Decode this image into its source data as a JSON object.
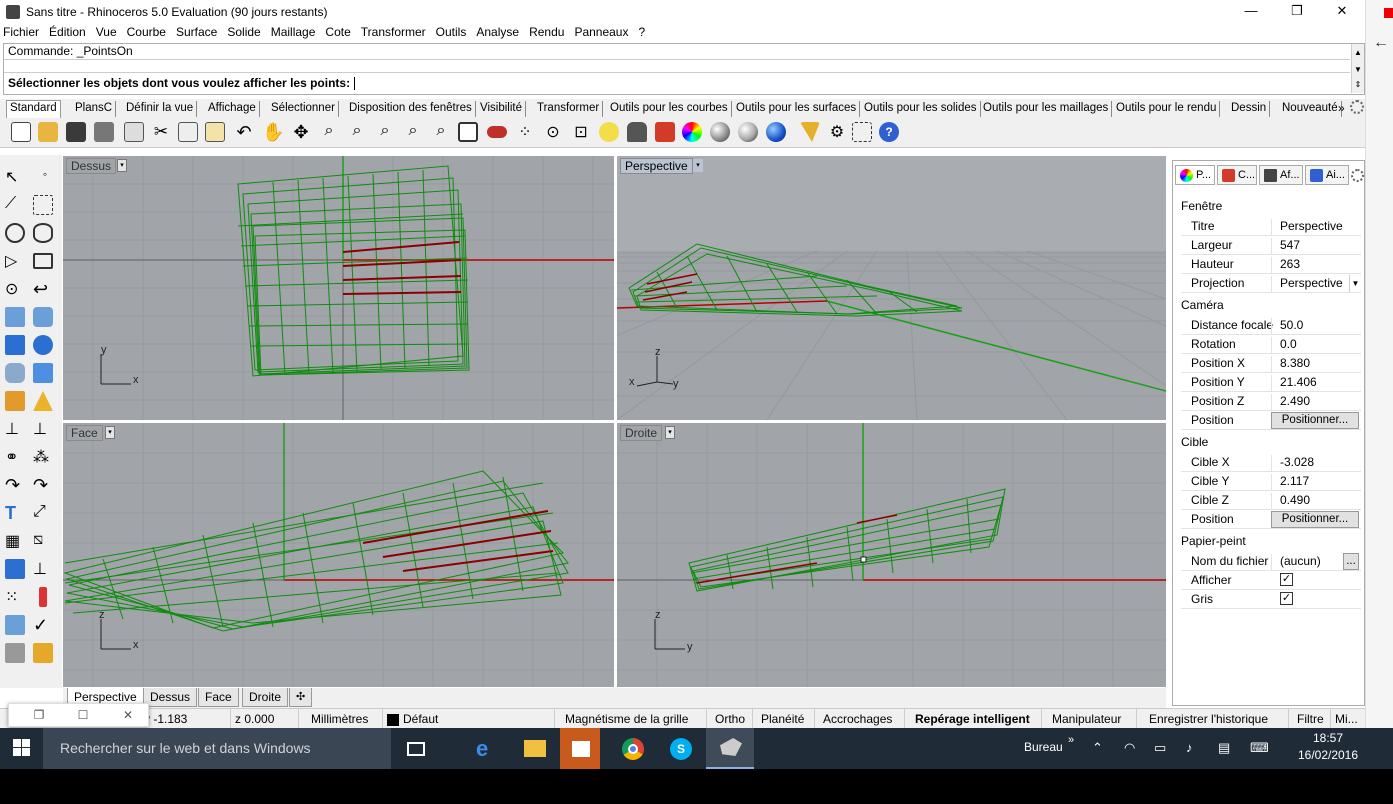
{
  "window": {
    "title": "Sans titre - Rhinoceros 5.0 Evaluation (90 jours restants)",
    "controls": {
      "minimize": "—",
      "restore": "❐",
      "close": "✕"
    }
  },
  "menu": [
    "Fichier",
    "Édition",
    "Vue",
    "Courbe",
    "Surface",
    "Solide",
    "Maillage",
    "Cote",
    "Transformer",
    "Outils",
    "Analyse",
    "Rendu",
    "Panneaux",
    "?"
  ],
  "command": {
    "history": "Commande: _PointsOn",
    "prompt": "Sélectionner les objets dont vous voulez afficher les points:"
  },
  "toolbar_tabs": [
    "Standard",
    "PlansC",
    "Définir la vue",
    "Affichage",
    "Sélectionner",
    "Disposition des fenêtres",
    "Visibilité",
    "Transformer",
    "Outils pour les courbes",
    "Outils pour les surfaces",
    "Outils pour les solides",
    "Outils pour les maillages",
    "Outils  pour le rendu",
    "Dessin",
    "Nouveauté"
  ],
  "toolbar_overflow": "»",
  "viewports": {
    "top": {
      "label": "Dessus",
      "axis_a": "y",
      "axis_b": "x"
    },
    "perspective": {
      "label": "Perspective",
      "axis_a": "z",
      "axis_b": "x",
      "axis_c": "y"
    },
    "front": {
      "label": "Face",
      "axis_a": "z",
      "axis_b": "x"
    },
    "right": {
      "label": "Droite",
      "axis_a": "z",
      "axis_b": "y"
    }
  },
  "viewport_tabs": [
    "Perspective",
    "Dessus",
    "Face",
    "Droite"
  ],
  "viewport_tab_add": "✣",
  "panel": {
    "tabs": [
      "P...",
      "C...",
      "Af...",
      "Ai..."
    ],
    "sections": {
      "fenetre": "Fenêtre",
      "camera": "Caméra",
      "cible": "Cible",
      "papier": "Papier-peint"
    },
    "fenetre_rows": [
      {
        "label": "Titre",
        "value": "Perspective"
      },
      {
        "label": "Largeur",
        "value": "547"
      },
      {
        "label": "Hauteur",
        "value": "263"
      },
      {
        "label": "Projection",
        "value": "Perspective"
      }
    ],
    "camera_rows": [
      {
        "label": "Distance focale",
        "value": "50.0"
      },
      {
        "label": "Rotation",
        "value": "0.0"
      },
      {
        "label": "Position X",
        "value": "8.380"
      },
      {
        "label": "Position Y",
        "value": "21.406"
      },
      {
        "label": "Position Z",
        "value": "2.490"
      }
    ],
    "camera_position": {
      "label": "Position",
      "button": "Positionner..."
    },
    "cible_rows": [
      {
        "label": "Cible X",
        "value": "-3.028"
      },
      {
        "label": "Cible Y",
        "value": "2.117"
      },
      {
        "label": "Cible Z",
        "value": "0.490"
      }
    ],
    "cible_position": {
      "label": "Position",
      "button": "Positionner..."
    },
    "papier_file": {
      "label": "Nom du fichier",
      "value": "(aucun)",
      "button": "..."
    },
    "papier_checks": [
      {
        "label": "Afficher",
        "checked": true
      },
      {
        "label": "Gris",
        "checked": true
      }
    ]
  },
  "statusbar": {
    "y": "y -1.183",
    "z": "z 0.000",
    "units": "Millimètres",
    "layer": "Défaut",
    "items": [
      "Magnétisme de la grille",
      "Ortho",
      "Planéité",
      "Accrochages",
      "Repérage intelligent",
      "Manipulateur",
      "Enregistrer l'historique",
      "Filtre",
      "Mi..."
    ]
  },
  "taskbar": {
    "search_placeholder": "Rechercher sur le web et dans Windows",
    "bureau": "Bureau",
    "time": "18:57",
    "date": "16/02/2016"
  },
  "colors": {
    "viewport_bg": "#a1a4a8",
    "mesh_green": "#0f8c0f",
    "axis_red": "#b80000",
    "axis_green": "#1aa01a",
    "taskbar": "#1f2b37"
  }
}
